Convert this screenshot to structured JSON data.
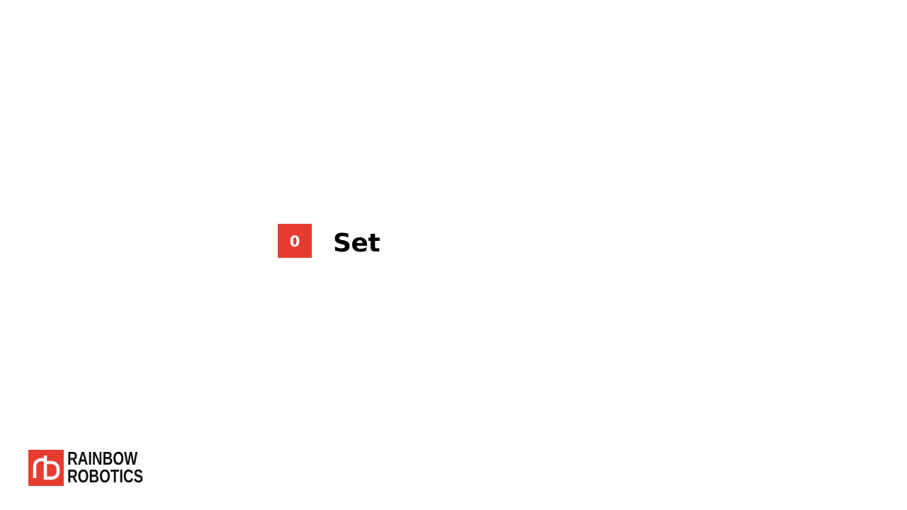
{
  "section": {
    "number": "0",
    "title": "Set"
  },
  "logo": {
    "line1": "RAINBOW",
    "line2": "ROBOTICS",
    "mark_text": "rb"
  },
  "colors": {
    "accent": "#e63c30",
    "text": "#000000",
    "background": "#ffffff"
  }
}
